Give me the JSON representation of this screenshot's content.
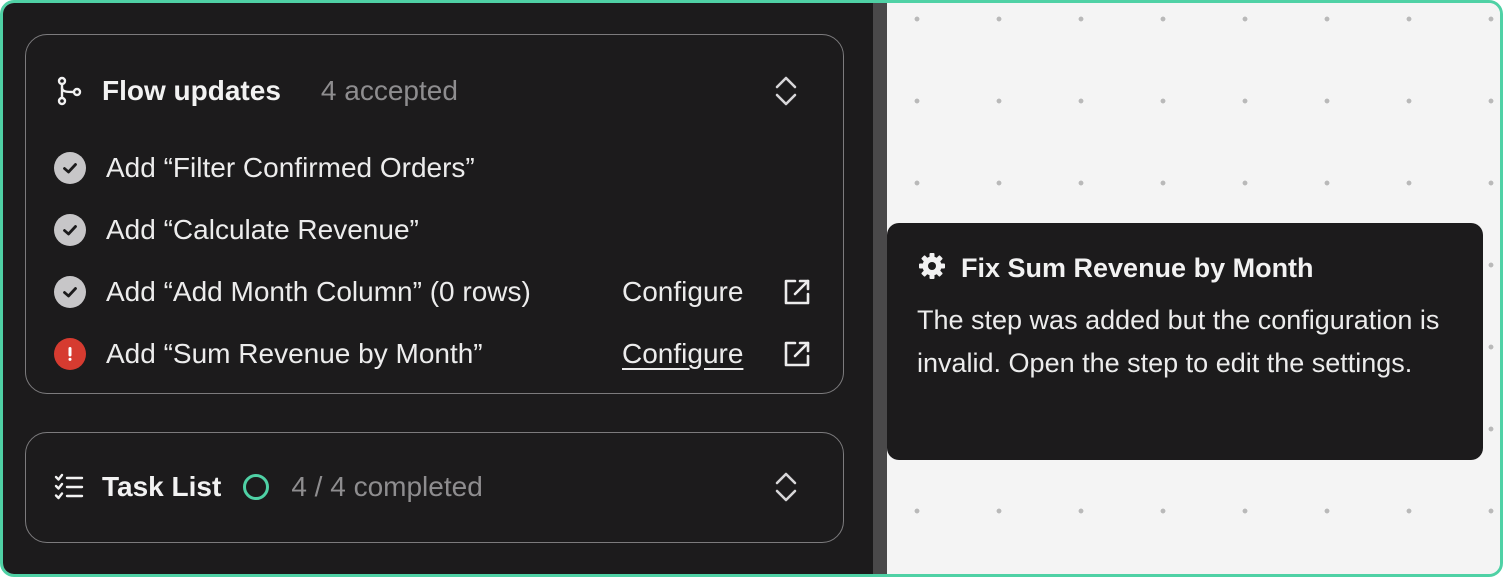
{
  "flow_updates": {
    "title": "Flow updates",
    "meta": "4 accepted",
    "items": [
      {
        "label": "Add “Filter Confirmed Orders”",
        "status": "accepted"
      },
      {
        "label": "Add “Calculate Revenue”",
        "status": "accepted"
      },
      {
        "label": "Add “Add Month Column” (0 rows)",
        "status": "accepted",
        "action": "Configure"
      },
      {
        "label": "Add “Sum Revenue by Month”",
        "status": "error",
        "action": "Configure"
      }
    ]
  },
  "task_list": {
    "title": "Task List",
    "meta": "4 / 4 completed"
  },
  "tooltip": {
    "title": "Fix Sum Revenue by Month",
    "body": "The step was added but the configuration is invalid. Open the step to edit the settings."
  },
  "icons": {
    "flow": "branch-icon",
    "expand": "chevron-up-down-icon",
    "accepted": "check-circle-icon",
    "error": "exclamation-circle-icon",
    "open": "external-link-icon",
    "tasks": "checklist-icon",
    "progress": "progress-ring-icon",
    "tooltip": "gear-icon"
  },
  "colors": {
    "panel_bg": "#1c1b1c",
    "accent": "#4fd1a5",
    "error": "#d63b30",
    "ok": "#c7c6c8",
    "muted_text": "#8e8d8f",
    "canvas_bg": "#f4f4f4"
  }
}
